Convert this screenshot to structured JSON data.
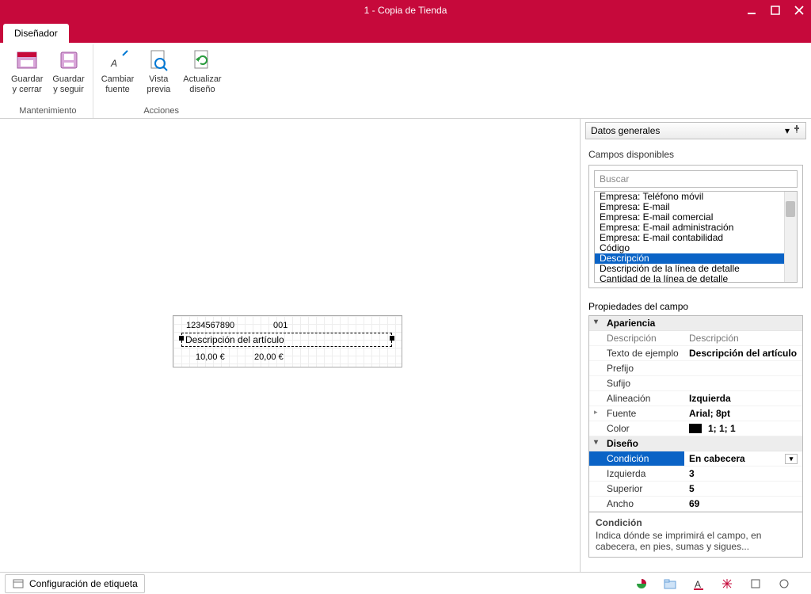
{
  "window": {
    "title": "1 - Copia de Tienda"
  },
  "tab": {
    "designer": "Diseñador"
  },
  "ribbon": {
    "group_maintenance": "Mantenimiento",
    "group_actions": "Acciones",
    "save_close": "Guardar\ny cerrar",
    "save_continue": "Guardar\ny seguir",
    "change_font": "Cambiar\nfuente",
    "preview": "Vista\nprevia",
    "refresh_design": "Actualizar\ndiseño"
  },
  "side_header": "Datos generales",
  "fields_panel": {
    "title": "Campos disponibles",
    "search_placeholder": "Buscar",
    "items": [
      "Empresa: Teléfono móvil",
      "Empresa: E-mail",
      "Empresa: E-mail comercial",
      "Empresa: E-mail administración",
      "Empresa: E-mail contabilidad",
      "Código",
      "Descripción",
      "Descripción de la línea de detalle",
      "Cantidad de la línea de detalle"
    ],
    "selected_index": 6
  },
  "canvas": {
    "code": "1234567890",
    "num": "001",
    "desc": "Descripción del artículo",
    "price1": "10,00  €",
    "price2": "20,00  €"
  },
  "props": {
    "title": "Propiedades del campo",
    "cat_appearance": "Apariencia",
    "cat_design": "Diseño",
    "rows": {
      "descripcion_k": "Descripción",
      "descripcion_v": "Descripción",
      "texto_k": "Texto de ejemplo",
      "texto_v": "Descripción del artículo",
      "prefijo_k": "Prefijo",
      "prefijo_v": "",
      "sufijo_k": "Sufijo",
      "sufijo_v": "",
      "alin_k": "Alineación",
      "alin_v": "Izquierda",
      "fuente_k": "Fuente",
      "fuente_v": "Arial; 8pt",
      "color_k": "Color",
      "color_v": "1; 1; 1",
      "cond_k": "Condición",
      "cond_v": "En cabecera",
      "izq_k": "Izquierda",
      "izq_v": "3",
      "sup_k": "Superior",
      "sup_v": "5",
      "ancho_k": "Ancho",
      "ancho_v": "69"
    },
    "help_title": "Condición",
    "help_body": "Indica dónde se imprimirá el campo, en cabecera, en pies, sumas y sigues..."
  },
  "status": {
    "config_label": "Configuración de etiqueta"
  }
}
